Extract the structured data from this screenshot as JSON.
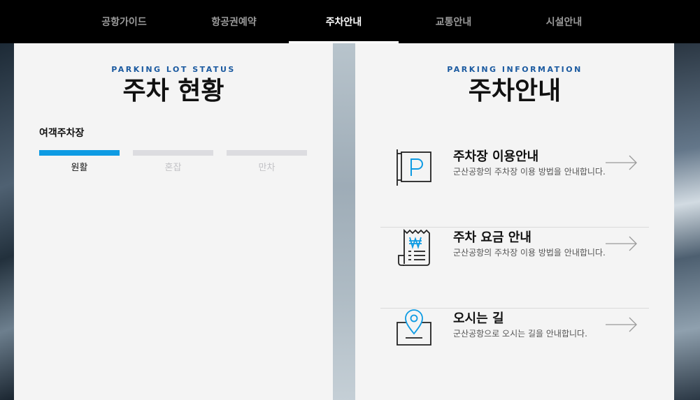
{
  "nav": {
    "tabs": [
      {
        "label": "공항가이드",
        "active": false
      },
      {
        "label": "항공권예약",
        "active": false
      },
      {
        "label": "주차안내",
        "active": true
      },
      {
        "label": "교통안내",
        "active": false
      },
      {
        "label": "시설안내",
        "active": false
      }
    ]
  },
  "parking_status": {
    "eyebrow": "PARKING LOT STATUS",
    "title": "주차 현황",
    "lot_name": "여객주차장",
    "levels": [
      {
        "label": "원활",
        "active": true
      },
      {
        "label": "혼잡",
        "active": false
      },
      {
        "label": "만차",
        "active": false
      }
    ]
  },
  "parking_info": {
    "eyebrow": "PARKING INFORMATION",
    "title": "주차안내",
    "items": [
      {
        "title": "주차장 이용안내",
        "desc": "군산공항의 주차장 이용 방법을 안내합니다.",
        "icon": "parking-sign-icon"
      },
      {
        "title": "주차 요금 안내",
        "desc": "군산공항의 주차장 이용 방법을 안내합니다.",
        "icon": "receipt-won-icon"
      },
      {
        "title": "오시는 길",
        "desc": "군산공항으로 오시는 길을 안내합니다.",
        "icon": "map-pin-icon"
      }
    ]
  },
  "colors": {
    "accent_blue": "#0e9be3",
    "eyebrow_blue": "#1b5aa0",
    "nav_bg": "#000000"
  }
}
